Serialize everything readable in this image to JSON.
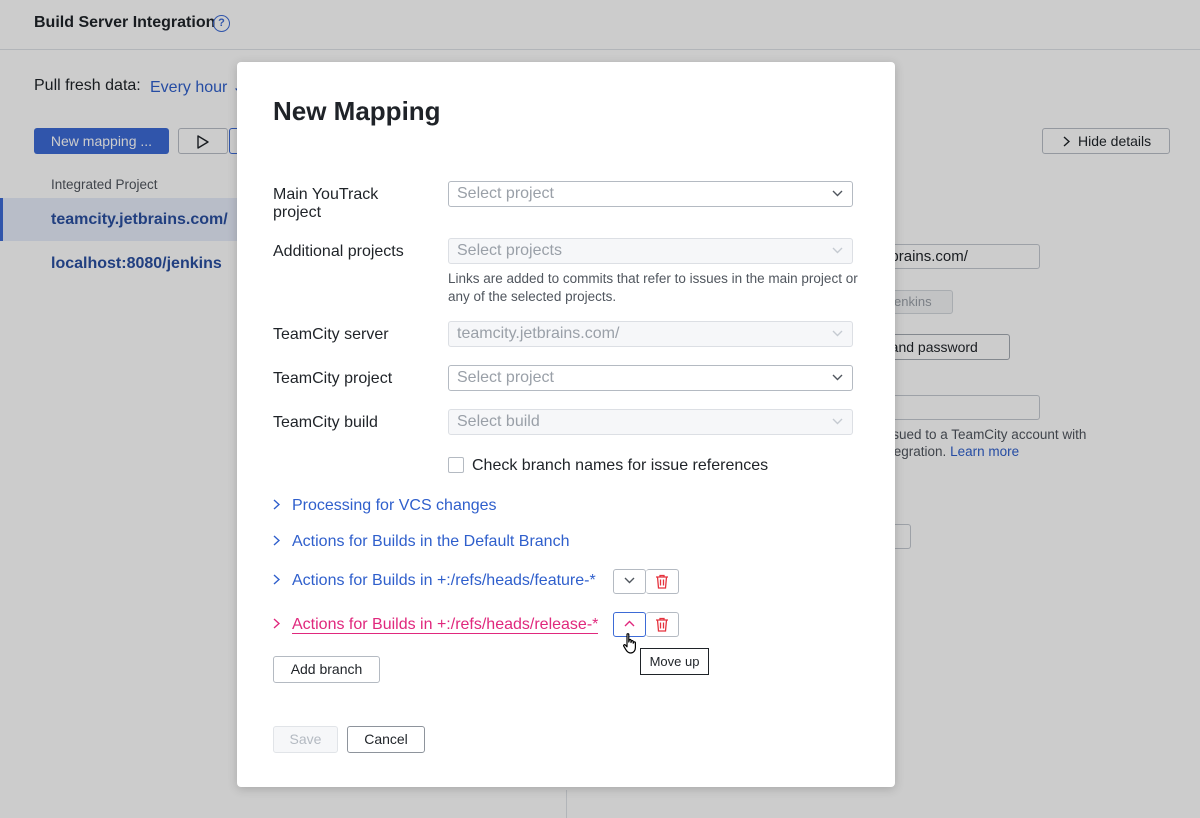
{
  "app": {
    "title": "Build Server Integration",
    "pull_label": "Pull fresh data:",
    "pull_value": "Every hour",
    "new_mapping_label": "New mapping ...",
    "column_header": "Integrated Project",
    "projects": [
      "teamcity.jetbrains.com/",
      "localhost:8080/jenkins"
    ],
    "hide_details_label": "Hide details",
    "server_url_fragment": "y.jetbrains.com/",
    "server_type_fragment": "enkins",
    "auth_fragment": "n and password",
    "note_line1": "s issued to a TeamCity account with",
    "note_line2": "ls integration.",
    "learn_more": "Learn more"
  },
  "modal": {
    "title": "New Mapping",
    "main_project_label": "Main YouTrack project",
    "main_project_placeholder": "Select project",
    "additional_label": "Additional projects",
    "additional_placeholder": "Select projects",
    "additional_hint": "Links are added to commits that refer to issues in the main project or any of the selected projects.",
    "tc_server_label": "TeamCity server",
    "tc_server_value": "teamcity.jetbrains.com/",
    "tc_project_label": "TeamCity project",
    "tc_project_placeholder": "Select project",
    "tc_build_label": "TeamCity build",
    "tc_build_placeholder": "Select build",
    "check_branch_label": "Check branch names for issue references",
    "sections": [
      "Processing for VCS changes",
      "Actions for Builds in the Default Branch",
      "Actions for Builds in +:/refs/heads/feature-*",
      "Actions for Builds in +:/refs/heads/release-*"
    ],
    "tooltip": "Move up",
    "add_branch_label": "Add branch",
    "save_label": "Save",
    "cancel_label": "Cancel"
  },
  "colors": {
    "accent": "#3d6bd6",
    "link": "#2f5fcc",
    "active_link": "#e0287d",
    "danger": "#e5323d"
  }
}
